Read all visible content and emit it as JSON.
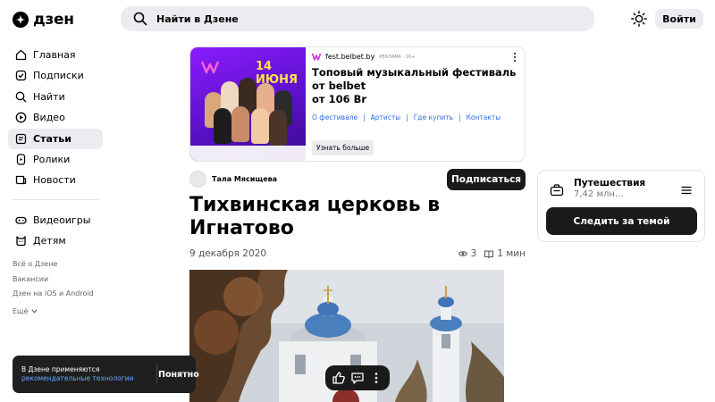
{
  "header": {
    "logo_text": "дзен",
    "search_placeholder": "Найти в Дзене",
    "login_label": "Войти"
  },
  "sidebar": {
    "items": [
      {
        "label": "Главная",
        "icon": "home-icon"
      },
      {
        "label": "Подписки",
        "icon": "subscriptions-icon"
      },
      {
        "label": "Найти",
        "icon": "search-icon"
      },
      {
        "label": "Видео",
        "icon": "video-icon"
      },
      {
        "label": "Статьи",
        "icon": "articles-icon",
        "active": true
      },
      {
        "label": "Ролики",
        "icon": "shorts-icon"
      },
      {
        "label": "Новости",
        "icon": "news-icon"
      }
    ],
    "items2": [
      {
        "label": "Видеоигры",
        "icon": "gamepad-icon"
      },
      {
        "label": "Детям",
        "icon": "kids-icon"
      }
    ],
    "footer": [
      "Всё о Дзене",
      "Вакансии",
      "Дзен на iOS и Android",
      "Ещё"
    ]
  },
  "ad": {
    "source": "fest.belbet.by",
    "tag": "РЕКЛАМА · 16+",
    "title": "Топовый музыкальный фестиваль от belbet",
    "price": "от 106 Br",
    "links": [
      "О фестивале",
      "Артисты",
      "Где купить",
      "Контакты"
    ],
    "button": "Узнать больше",
    "image_date": "14 ИЮНЯ"
  },
  "author": {
    "name": "Тала Мясищева",
    "subscribe_label": "Подписаться"
  },
  "article": {
    "title": "Тихвинская церковь в Игнатово",
    "date": "9 декабря 2020",
    "views": "3",
    "read_time": "1 мин"
  },
  "cookie": {
    "text": "В Дзене применяются",
    "link": "рекомендательные технологии",
    "ok_label": "Понятно"
  },
  "topic": {
    "name": "Путешествия",
    "count": "7,42 млн…",
    "follow_label": "Следить за темой"
  },
  "colors": {
    "accent_dark": "#1a1a1a",
    "search_bg": "#ebecef",
    "link": "#2c6ee0",
    "ad_purple": "#6a14e0"
  }
}
